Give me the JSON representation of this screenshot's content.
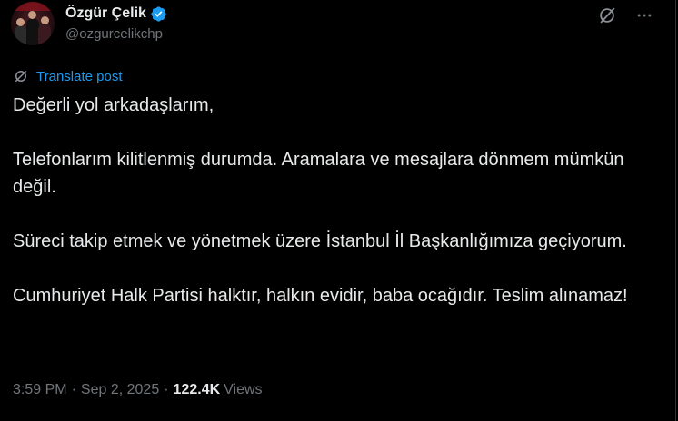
{
  "author": {
    "display_name": "Özgür Çelik",
    "handle": "@ozgurcelikchp",
    "verified": true,
    "verified_color": "#1d9bf0"
  },
  "actions": {
    "grok_icon": "grok-icon",
    "more_icon": "more-icon"
  },
  "translate": {
    "label": "Translate post",
    "icon": "grok-translate-icon",
    "color": "#1d9bf0"
  },
  "post": {
    "paragraphs": [
      "Değerli yol arkadaşlarım,",
      "Telefonlarım kilitlenmiş durumda. Aramalara ve mesajlara dönmem mümkün değil.",
      "Süreci takip etmek ve yönetmek üzere İstanbul İl Başkanlığımıza geçiyorum.",
      "Cumhuriyet Halk Partisi halktır, halkın evidir, baba ocağıdır. Teslim alınamaz!"
    ]
  },
  "meta": {
    "time": "3:59 PM",
    "separator": "·",
    "date": "Sep 2, 2025",
    "views_count": "122.4K",
    "views_label": "Views"
  },
  "colors": {
    "background": "#000000",
    "text": "#e7e9ea",
    "secondary_text": "#71767b",
    "accent": "#1d9bf0"
  }
}
